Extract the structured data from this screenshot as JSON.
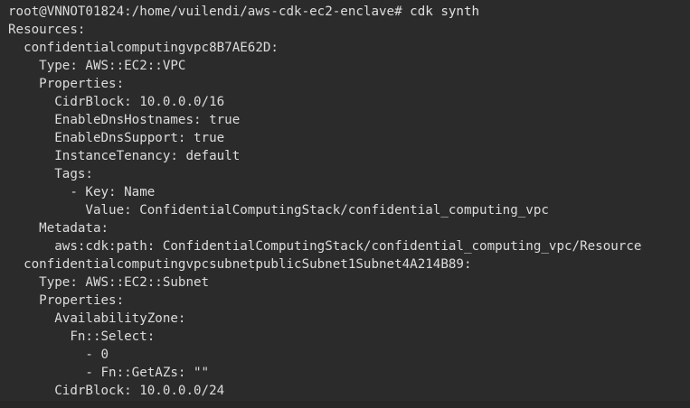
{
  "terminal": {
    "prompt": "root@VNNOT01824:/home/vuilendi/aws-cdk-ec2-enclave# ",
    "command": "cdk synth",
    "lines": [
      "Resources:",
      "  confidentialcomputingvpc8B7AE62D:",
      "    Type: AWS::EC2::VPC",
      "    Properties:",
      "      CidrBlock: 10.0.0.0/16",
      "      EnableDnsHostnames: true",
      "      EnableDnsSupport: true",
      "      InstanceTenancy: default",
      "      Tags:",
      "        - Key: Name",
      "          Value: ConfidentialComputingStack/confidential_computing_vpc",
      "    Metadata:",
      "      aws:cdk:path: ConfidentialComputingStack/confidential_computing_vpc/Resource",
      "  confidentialcomputingvpcsubnetpublicSubnet1Subnet4A214B89:",
      "    Type: AWS::EC2::Subnet",
      "    Properties:",
      "      AvailabilityZone:",
      "        Fn::Select:",
      "          - 0",
      "          - Fn::GetAZs: \"\"",
      "      CidrBlock: 10.0.0.0/24"
    ]
  }
}
